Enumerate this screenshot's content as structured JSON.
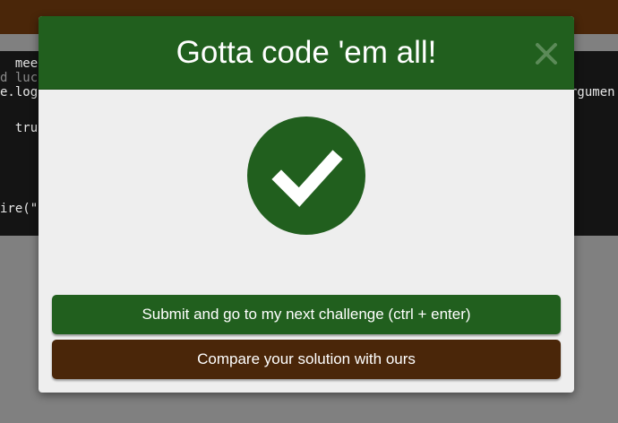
{
  "background_editor": {
    "lines": [
      "  meet",
      "d luc",
      "e.log",
      "",
      "  true",
      "",
      "",
      "",
      "",
      "ire(\"",
      "rgumen"
    ]
  },
  "modal": {
    "title": "Gotta code 'em all!",
    "close_icon": "close-x-icon",
    "success_icon": "checkmark-circle-icon",
    "submit_label": "Submit and go to my next challenge (ctrl + enter)",
    "compare_label": "Compare your solution with ours"
  },
  "colors": {
    "header_green": "#215f1e",
    "brown": "#4a2609",
    "modal_body": "#eeeeee",
    "overlay_gray": "#808080",
    "editor_bg": "#141414"
  }
}
